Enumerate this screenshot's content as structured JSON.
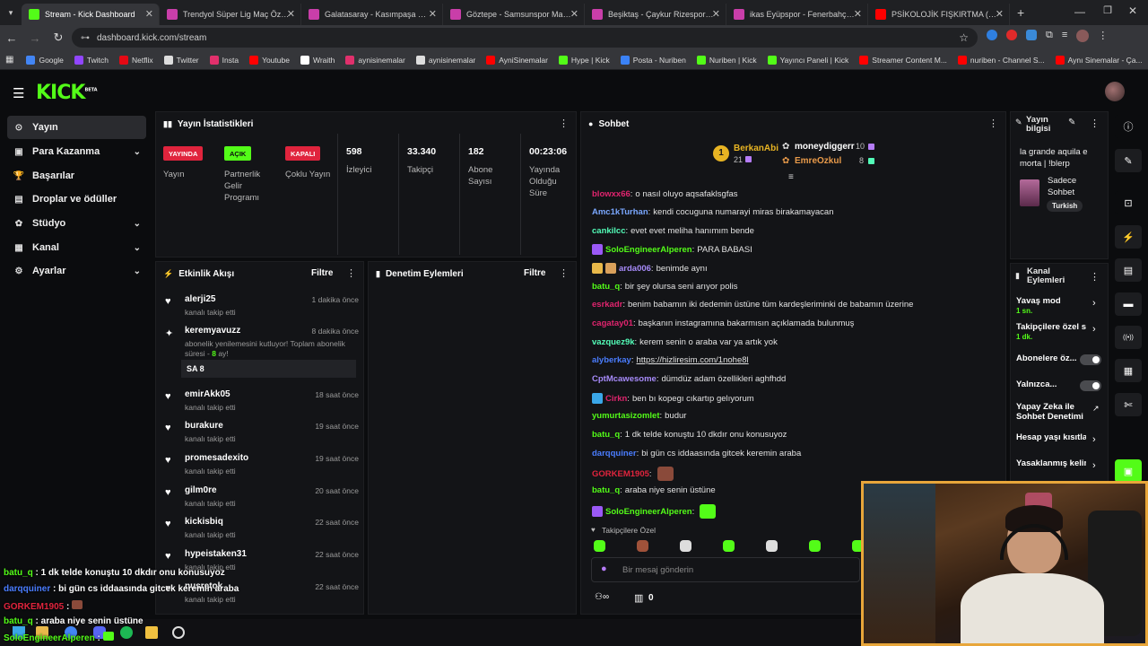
{
  "browser": {
    "tabs": [
      {
        "title": "Stream - Kick Dashboard",
        "color": "#53fc18",
        "active": true
      },
      {
        "title": "Trendyol Süper Lig Maç Özetle",
        "color": "#c93ea9"
      },
      {
        "title": "Galatasaray - Kasımpaşa Maç Ö",
        "color": "#c93ea9"
      },
      {
        "title": "Göztepe - Samsunspor Maç Öze",
        "color": "#c93ea9"
      },
      {
        "title": "Beşiktaş - Çaykur Rizespor Ma",
        "color": "#c93ea9"
      },
      {
        "title": "ikas Eyüpspor - Fenerbahçe Ma",
        "color": "#c93ea9"
      },
      {
        "title": "PSİKOLOJİK FIŞKIRTMA (ÖZET...",
        "color": "#ff0000"
      }
    ],
    "url": "dashboard.kick.com/stream",
    "bookmarks": [
      {
        "label": "Google",
        "color": "#4285f4"
      },
      {
        "label": "Twitch",
        "color": "#9146ff"
      },
      {
        "label": "Netflix",
        "color": "#e50914"
      },
      {
        "label": "Twitter",
        "color": "#dddddd"
      },
      {
        "label": "Insta",
        "color": "#e1306c"
      },
      {
        "label": "Youtube",
        "color": "#ff0000"
      },
      {
        "label": "Wraith",
        "color": "#ffffff"
      },
      {
        "label": "aynisinemalar",
        "color": "#e1306c"
      },
      {
        "label": "aynisinemalar",
        "color": "#dddddd"
      },
      {
        "label": "AyniSinemalar",
        "color": "#ff0000"
      },
      {
        "label": "Hype | Kick",
        "color": "#53fc18"
      },
      {
        "label": "Posta - Nuriben",
        "color": "#3b82f6"
      },
      {
        "label": "Nuriben | Kick",
        "color": "#53fc18"
      },
      {
        "label": "Yayıncı Paneli | Kick",
        "color": "#53fc18"
      },
      {
        "label": "Streamer Content M...",
        "color": "#ff0000"
      },
      {
        "label": "nuriben - Channel S...",
        "color": "#ff0000"
      },
      {
        "label": "Aynı Sinemalar - Ça...",
        "color": "#ff0000"
      }
    ]
  },
  "kick": {
    "logo": "KICK",
    "logo_sup": "BETA"
  },
  "sidebar": {
    "items": [
      {
        "label": "Yayın",
        "icon": "broadcast-icon",
        "glyph": "((•))"
      },
      {
        "label": "Para Kazanma",
        "icon": "money-icon",
        "glyph": "▣"
      },
      {
        "label": "Başarılar",
        "icon": "trophy-icon",
        "glyph": "🏆"
      },
      {
        "label": "Droplar ve ödüller",
        "icon": "gift-icon",
        "glyph": "▤"
      },
      {
        "label": "Stüdyo",
        "icon": "gear-icon",
        "glyph": "✿"
      },
      {
        "label": "Kanal",
        "icon": "channel-icon",
        "glyph": "▦"
      },
      {
        "label": "Ayarlar",
        "icon": "settings-icon",
        "glyph": "⚙"
      }
    ]
  },
  "stats": {
    "title": "Yayın İstatistikleri",
    "badges": [
      {
        "badge": "YAYINDA",
        "label": "Yayın",
        "bg": "#e0243d",
        "fg": "#ffffff"
      },
      {
        "badge": "AÇIK",
        "label": "Partnerlik Gelir Programı",
        "bg": "#53fc18",
        "fg": "#0b0c0e"
      },
      {
        "badge": "KAPALI",
        "label": "Çoklu Yayın",
        "bg": "#e0243d",
        "fg": "#ffffff"
      }
    ],
    "numbers": [
      {
        "value": "598",
        "label": "İzleyici"
      },
      {
        "value": "33.340",
        "label": "Takipçi"
      },
      {
        "value": "182",
        "label": "Abone Sayısı"
      },
      {
        "value": "00:23:06",
        "label": "Yayında Olduğu Süre"
      }
    ]
  },
  "activity": {
    "title": "Etkinlik Akışı",
    "filter": "Filtre",
    "items": [
      {
        "name": "alerji25",
        "sub": "kanalı takip etti",
        "time": "1 dakika önce"
      },
      {
        "name": "keremyavuzz",
        "sub": "abonelik yenilemesini kutluyor! Toplam abonelik süresi - ",
        "months": "8",
        "unit": " ay!",
        "time": "8 dakika önce",
        "note": "SA 8"
      },
      {
        "name": "emirAkk05",
        "sub": "kanalı takip etti",
        "time": "18 saat önce"
      },
      {
        "name": "burakure",
        "sub": "kanalı takip etti",
        "time": "19 saat önce"
      },
      {
        "name": "promesadexito",
        "sub": "kanalı takip etti",
        "time": "19 saat önce"
      },
      {
        "name": "gilm0re",
        "sub": "kanalı takip etti",
        "time": "20 saat önce"
      },
      {
        "name": "kickisbiq",
        "sub": "kanalı takip etti",
        "time": "22 saat önce"
      },
      {
        "name": "hypeistaken31",
        "sub": "kanalı takip etti",
        "time": "22 saat önce"
      },
      {
        "name": "nusretok",
        "sub": "kanalı takip etti",
        "time": "22 saat önce"
      }
    ]
  },
  "moderation": {
    "title": "Denetim Eylemleri",
    "filter": "Filtre"
  },
  "chat": {
    "title": "Sohbet",
    "leaderboard": [
      {
        "rank": "1",
        "name": "BerkanAbi",
        "count": "21"
      },
      {
        "name": "moneydiggerr",
        "count": "10"
      },
      {
        "name": "EmreOzkul",
        "count": "8"
      }
    ],
    "messages": [
      {
        "user": "blowxx66",
        "color": "#e0246e",
        "text": "o nasıl oluyo aqsafaklsgfas"
      },
      {
        "user": "Amc1kTurhan",
        "color": "#7aa7ff",
        "text": "kendi cocuguna numarayi miras birakamayacan"
      },
      {
        "user": "cankilcc",
        "color": "#53fcb8",
        "text": "evet evet meliha hanımım bende"
      },
      {
        "user": "SoloEngineerAlperen",
        "color": "#53fc18",
        "text": "PARA BABASI",
        "badge": "#9b59f6"
      },
      {
        "user": "arda006",
        "color": "#a78bfa",
        "text": "benimde aynı",
        "badge": "#e8b84a",
        "badge2": "#d9a05b"
      },
      {
        "user": "batu_q",
        "color": "#53fc18",
        "text": "bir şey olursa seni arıyor polis"
      },
      {
        "user": "esrkadr",
        "color": "#e0246e",
        "text": "benim babamın iki dedemin üstüne tüm kardeşleriminki de babamın üzerine"
      },
      {
        "user": "cagatay01",
        "color": "#e0246e",
        "text": "başkanın instagramına bakarmısın açıklamada bulunmuş"
      },
      {
        "user": "vazquez9k",
        "color": "#53fcb8",
        "text": "kerem senin o araba var ya artık yok"
      },
      {
        "user": "alyberkay",
        "color": "#4a7dff",
        "text": "https://hizliresim.com/1nohe8l",
        "link": true
      },
      {
        "user": "CptMcawesome",
        "color": "#a78bfa",
        "text": "dümdüz adam özellikleri aghfhdd"
      },
      {
        "user": "Cirkn",
        "color": "#e0246e",
        "text": "ben bı kopegı cıkartıp gelıyorum",
        "badge": "#3aa7e8"
      },
      {
        "user": "yumurtasizomlet",
        "color": "#53fc18",
        "text": "budur"
      },
      {
        "user": "batu_q",
        "color": "#53fc18",
        "text": "1 dk telde konuştu 10 dkdır onu konusuyoz"
      },
      {
        "user": "darqquiner",
        "color": "#4a7dff",
        "text": "bi gün cs iddaasında gitcek keremin araba"
      },
      {
        "user": "GORKEM1905",
        "color": "#e0243d",
        "text": "",
        "emote": "#8a4a3a"
      },
      {
        "user": "batu_q",
        "color": "#53fc18",
        "text": "araba niye senin üstüne"
      },
      {
        "user": "SoloEngineerAlperen",
        "color": "#53fc18",
        "text": "",
        "badge": "#9b59f6",
        "emote": "#53fc18"
      }
    ],
    "followers_only": "Takipçilere Özel",
    "input_placeholder": "Bir mesaj gönderin",
    "bottom_count": "0"
  },
  "stream_info": {
    "title": "Yayın bilgisi",
    "stream_title": "la grande aquila e morta | !blerp",
    "category": "Sadece Sohbet",
    "language": "Turkish"
  },
  "channel_actions": {
    "title": "Kanal Eylemleri",
    "items": [
      {
        "label": "Yavaş mod",
        "sub": "1 sn.",
        "control": "chevron"
      },
      {
        "label": "Takipçilere özel s",
        "sub": "1 dk.",
        "control": "chevron"
      },
      {
        "label": "Abonelere öz...",
        "control": "toggle"
      },
      {
        "label": "Yalnızca...",
        "control": "toggle"
      },
      {
        "label": "Yapay Zeka ile Sohbet Denetimi",
        "control": "external"
      },
      {
        "label": "Hesap yaşı kısıtla",
        "control": "chevron"
      },
      {
        "label": "Yasaklanmış kelim",
        "control": "chevron"
      }
    ]
  },
  "overlay_chat": [
    {
      "user": "batu_q",
      "color": "#53fc18",
      "text": "1 dk telde konuştu 10 dkdır onu konusuyoz"
    },
    {
      "user": "darqquiner",
      "color": "#4a7dff",
      "text": "bi gün cs iddaasında gitcek keremin araba"
    },
    {
      "user": "GORKEM1905",
      "color": "#e0243d",
      "text": ""
    },
    {
      "user": "batu_q",
      "color": "#53fc18",
      "text": "araba niye senin üstüne"
    },
    {
      "user": "SoloEngineerAlperen",
      "color": "#53fc18",
      "text": ""
    }
  ]
}
